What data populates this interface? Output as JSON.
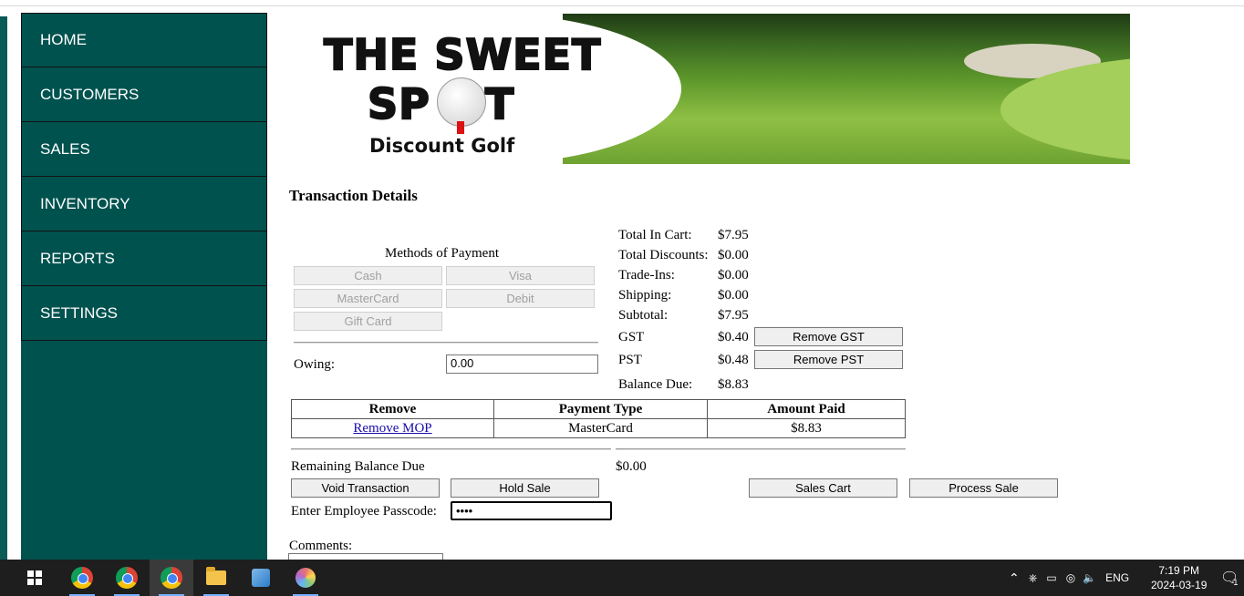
{
  "nav": {
    "items": [
      {
        "label": "HOME"
      },
      {
        "label": "CUSTOMERS"
      },
      {
        "label": "SALES"
      },
      {
        "label": "INVENTORY"
      },
      {
        "label": "REPORTS"
      },
      {
        "label": "SETTINGS"
      }
    ]
  },
  "banner": {
    "line1": "THE SWEET",
    "line2_part1": "SP",
    "line2_part2": "T",
    "subtitle": "Discount Golf"
  },
  "page": {
    "title": "Transaction Details"
  },
  "payment_methods": {
    "heading": "Methods of Payment",
    "cash": "Cash",
    "visa": "Visa",
    "mastercard": "MasterCard",
    "debit": "Debit",
    "gift_card": "Gift Card"
  },
  "owing": {
    "label": "Owing:",
    "value": "0.00"
  },
  "summary": {
    "total_in_cart_label": "Total In Cart:",
    "total_in_cart": "$7.95",
    "total_discounts_label": "Total Discounts:",
    "total_discounts": "$0.00",
    "trade_ins_label": "Trade-Ins:",
    "trade_ins": "$0.00",
    "shipping_label": "Shipping:",
    "shipping": "$0.00",
    "subtotal_label": "Subtotal:",
    "subtotal": "$7.95",
    "gst_label": "GST",
    "gst": "$0.40",
    "remove_gst": "Remove GST",
    "pst_label": "PST",
    "pst": "$0.48",
    "remove_pst": "Remove PST",
    "balance_due_label": "Balance Due:",
    "balance_due": "$8.83"
  },
  "payments_table": {
    "headers": [
      "Remove",
      "Payment Type",
      "Amount Paid"
    ],
    "rows": [
      {
        "remove": "Remove MOP",
        "type": "MasterCard",
        "amount": "$8.83"
      }
    ]
  },
  "remaining": {
    "label": "Remaining Balance Due",
    "value": "$0.00"
  },
  "actions": {
    "void": "Void Transaction",
    "hold": "Hold Sale",
    "sales_cart": "Sales Cart",
    "process": "Process Sale"
  },
  "passcode": {
    "label": "Enter Employee Passcode:",
    "value": "••••"
  },
  "comments": {
    "label": "Comments:"
  },
  "taskbar": {
    "lang": "ENG",
    "time": "7:19 PM",
    "date": "2024-03-19",
    "notification_count": "1"
  }
}
